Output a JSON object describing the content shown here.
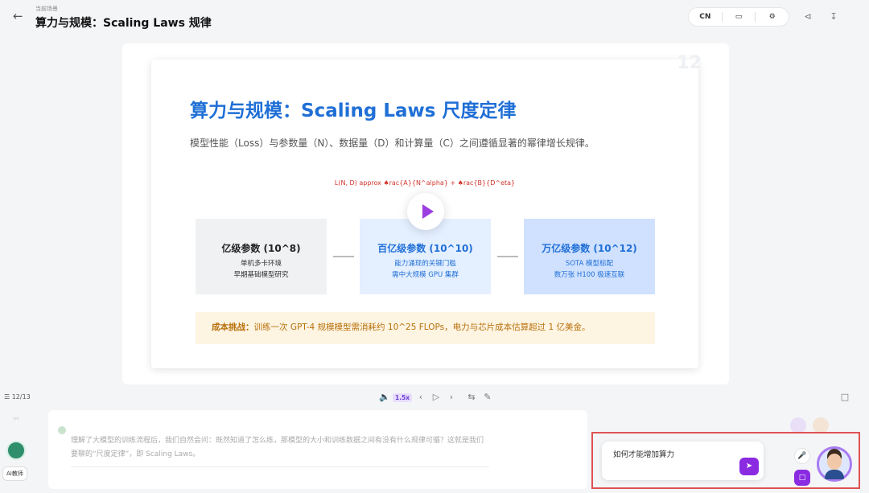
{
  "header": {
    "crumb": "当前场景",
    "title": "算力与规模：Scaling Laws 规律",
    "lang": "CN",
    "icons": [
      "back-arrow-icon",
      "monitor-icon",
      "gear-icon",
      "share-icon",
      "download-icon"
    ]
  },
  "slide": {
    "page_watermark": "12",
    "title": "算力与规模：Scaling Laws 尺度定律",
    "subtitle": "模型性能（Loss）与参数量（N）、数据量（D）和计算量（C）之间遵循显著的幂律增长规律。",
    "formula": "L(N, D) approx ♠rac{A}{N^alpha} + ♠rac{B}{D^\beta}",
    "boxes": [
      {
        "title": "亿级参数 (10^8)",
        "line1": "单机多卡环境",
        "line2": "早期基础模型研究"
      },
      {
        "title": "百亿级参数 (10^10)",
        "line1": "能力涌现的关键门槛",
        "line2": "需中大规模 GPU 集群"
      },
      {
        "title": "万亿级参数 (10^12)",
        "line1": "SOTA 模型标配",
        "line2": "数万张 H100 极速互联"
      }
    ],
    "notice_label": "成本挑战：",
    "notice_text": "训练一次 GPT-4 规模模型需消耗约 10^25 FLOPs，电力与芯片成本估算超过 1 亿美金。"
  },
  "player": {
    "page": "12/13",
    "speed": "1.5x"
  },
  "chat": {
    "text": "理解了大模型的训练流程后，我们自然会问：既然知道了怎么练，那模型的大小和训练数据之间有没有什么规律可循？这就是我们要聊的“尺度定律”，即 Scaling Laws。",
    "ai_label": "AI教师"
  },
  "ask": {
    "value": "如何才能增加算力"
  },
  "colors": {
    "accent": "#8a2be2",
    "title_blue": "#1f6fd6",
    "highlight_border": "#e05252"
  }
}
